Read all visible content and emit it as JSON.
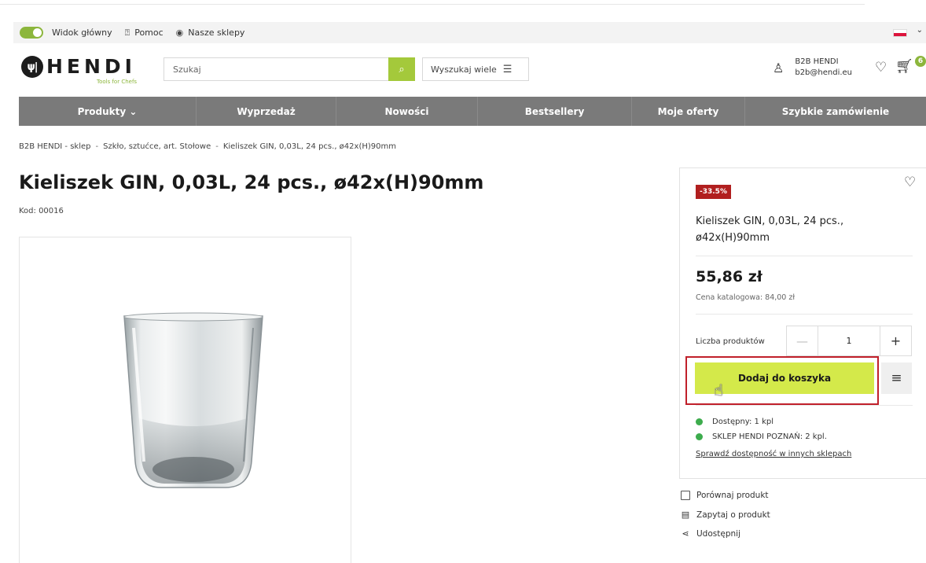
{
  "utility": {
    "toggle_label": "Widok główny",
    "help": "Pomoc",
    "stores": "Nasze sklepy"
  },
  "logo": {
    "word": "HENDI",
    "tagline": "Tools for Chefs"
  },
  "search": {
    "placeholder": "Szukaj",
    "multi_label": "Wyszukaj wiele"
  },
  "user": {
    "name": "B2B HENDI",
    "email": "b2b@hendi.eu"
  },
  "cart": {
    "count": "6"
  },
  "nav": [
    {
      "label": "Produkty ⌄"
    },
    {
      "label": "Wyprzedaż"
    },
    {
      "label": "Nowości"
    },
    {
      "label": "Bestsellery"
    },
    {
      "label": "Moje oferty"
    },
    {
      "label": "Szybkie zamówienie"
    }
  ],
  "breadcrumb": [
    "B2B HENDI - sklep",
    "Szkło, sztućce, art. Stołowe",
    "Kieliszek GIN, 0,03L, 24 pcs., ø42x(H)90mm"
  ],
  "breadcrumb_sep": "-",
  "product": {
    "title": "Kieliszek GIN, 0,03L, 24 pcs., ø42x(H)90mm",
    "code": "Kod: 00016",
    "discount": "-33.5%",
    "panel_name": "Kieliszek GIN, 0,03L, 24 pcs., ø42x(H)90mm",
    "price": "55,86 zł",
    "catalog_price": "Cena katalogowa: 84,00 zł",
    "qty_label": "Liczba produktów",
    "qty_value": "1",
    "add_to_cart": "Dodaj do koszyka",
    "availability": [
      "Dostępny: 1 kpl",
      "SKLEP HENDI POZNAŃ: 2 kpl."
    ],
    "check_other": "Sprawdź dostępność w innych sklepach",
    "status_color": "#3dac4d",
    "accent_color": "#d4e94a"
  },
  "actions": {
    "compare": "Porównaj produkt",
    "ask": "Zapytaj o produkt",
    "share": "Udostępnij"
  }
}
